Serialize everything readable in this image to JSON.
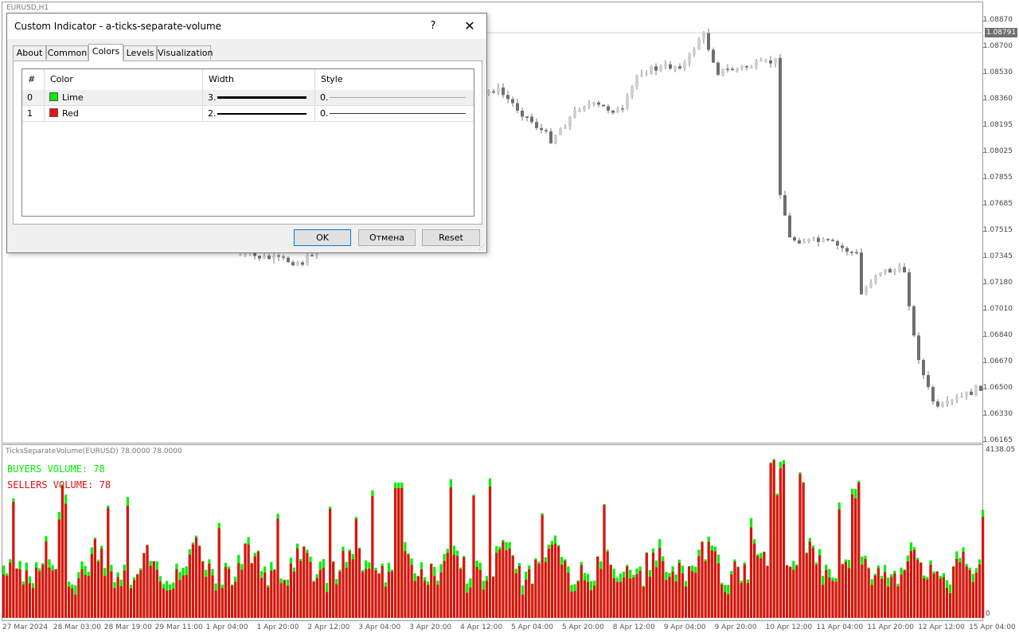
{
  "main_chart": {
    "symbol_label": "EURUSD,H1",
    "price_labels": [
      "1.08870",
      "1.08700",
      "1.08530",
      "1.08360",
      "1.08195",
      "1.08025",
      "1.07855",
      "1.07685",
      "1.07515",
      "1.07345",
      "1.07180",
      "1.07010",
      "1.06840",
      "1.06670",
      "1.06500",
      "1.06330",
      "1.06165"
    ],
    "current_price": "1.08791"
  },
  "sub_window": {
    "label": "TicksSeparateVolume(EURUSD) 78.0000 78.0000",
    "scale_top": "4138.05",
    "scale_bottom": "0",
    "buyers_text": "BUYERS VOLUME: 78",
    "sellers_text": "SELLERS VOLUME: 78",
    "buyers_color": "#00ee00",
    "sellers_color": "#dd1111"
  },
  "time_labels": [
    "27 Mar 2024",
    "28 Mar 03:00",
    "28 Mar 19:00",
    "29 Mar 11:00",
    "1 Apr 04:00",
    "1 Apr 20:00",
    "2 Apr 12:00",
    "3 Apr 04:00",
    "3 Apr 20:00",
    "4 Apr 12:00",
    "5 Apr 04:00",
    "5 Apr 20:00",
    "8 Apr 12:00",
    "9 Apr 04:00",
    "9 Apr 20:00",
    "10 Apr 12:00",
    "11 Apr 04:00",
    "11 Apr 20:00",
    "12 Apr 12:00",
    "15 Apr 04:00"
  ],
  "dialog": {
    "title": "Custom Indicator - a-ticks-separate-volume",
    "help": "?",
    "close": "✕",
    "tabs": [
      "About",
      "Common",
      "Colors",
      "Levels",
      "Visualization"
    ],
    "active_tab": "Colors",
    "columns": [
      "#",
      "Color",
      "Width",
      "Style"
    ],
    "rows": [
      {
        "index": "0",
        "color_name": "Lime",
        "color": "#00ee00",
        "width": "3.",
        "style": "0."
      },
      {
        "index": "1",
        "color_name": "Red",
        "color": "#ee1111",
        "width": "2.",
        "style": "0."
      }
    ],
    "buttons": {
      "ok": "OK",
      "cancel": "Отмена",
      "reset": "Reset"
    }
  }
}
